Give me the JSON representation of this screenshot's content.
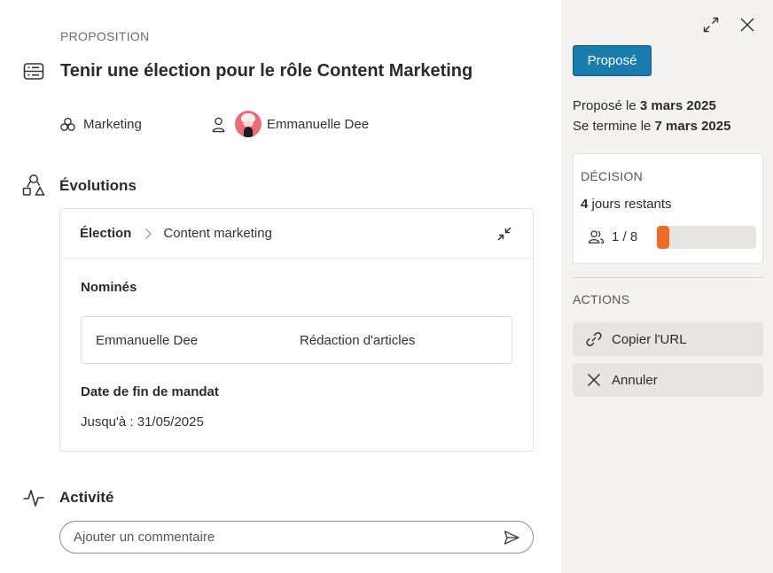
{
  "proposal": {
    "eyebrow": "PROPOSITION",
    "title": "Tenir une élection pour le rôle Content Marketing",
    "title_icon": "server-card-icon",
    "team": "Marketing",
    "team_icon": "circles-group-icon",
    "owner": "Emmanuelle Dee",
    "owner_icon": "user-icon"
  },
  "evolutions": {
    "title": "Évolutions",
    "icon": "shapes-icon",
    "card": {
      "type": "Élection",
      "role": "Content marketing",
      "nominees_label": "Nominés",
      "nominees": [
        {
          "name": "Emmanuelle Dee",
          "role": "Rédaction d'articles"
        }
      ],
      "end_label": "Date de fin de mandat",
      "end_value": "Jusqu'à : 31/05/2025"
    }
  },
  "activity": {
    "title": "Activité",
    "icon": "pulse-icon",
    "comment_placeholder": "Ajouter un commentaire"
  },
  "sidebar": {
    "status": "Proposé",
    "proposed_prefix": "Proposé le ",
    "proposed_date": "3 mars 2025",
    "ends_prefix": "Se termine le ",
    "ends_date": "7 mars 2025",
    "decision": {
      "label": "DÉCISION",
      "days_number": "4",
      "days_suffix": " jours restants",
      "votes": "1 / 8",
      "progress_fraction": 0.125,
      "progress_color": "#f26a2a"
    },
    "actions_label": "ACTIONS",
    "actions": [
      {
        "label": "Copier l'URL",
        "icon": "link-icon"
      },
      {
        "label": "Annuler",
        "icon": "close-icon"
      }
    ]
  },
  "colors": {
    "status_bg": "#1a7cad",
    "sidebar_bg": "#f4f3f1",
    "action_bg": "#e6e5e2"
  }
}
